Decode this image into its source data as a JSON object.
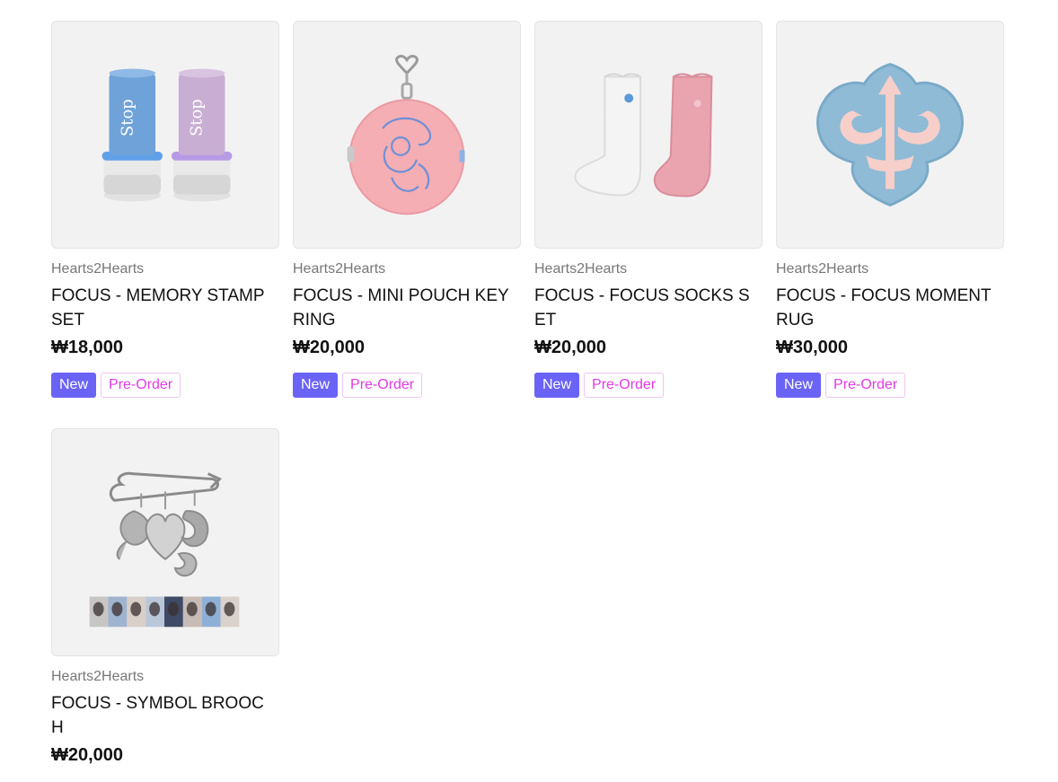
{
  "products": [
    {
      "brand": "Hearts2Hearts",
      "name": "FOCUS - MEMORY STAMP SET",
      "price": "₩18,000",
      "badges": {
        "new": "New",
        "preorder": "Pre-Order"
      },
      "image_icon": "stamp-set-image"
    },
    {
      "brand": "Hearts2Hearts",
      "name": "FOCUS - MINI POUCH KEYRING",
      "price": "₩20,000",
      "badges": {
        "new": "New",
        "preorder": "Pre-Order"
      },
      "image_icon": "pouch-keyring-image"
    },
    {
      "brand": "Hearts2Hearts",
      "name": "FOCUS - FOCUS SOCKS SET",
      "price": "₩20,000",
      "badges": {
        "new": "New",
        "preorder": "Pre-Order"
      },
      "image_icon": "socks-set-image"
    },
    {
      "brand": "Hearts2Hearts",
      "name": "FOCUS - FOCUS MOMENT RUG",
      "price": "₩30,000",
      "badges": {
        "new": "New",
        "preorder": "Pre-Order"
      },
      "image_icon": "moment-rug-image"
    },
    {
      "brand": "Hearts2Hearts",
      "name": "FOCUS - SYMBOL BROOCH",
      "price": "₩20,000",
      "image_icon": "symbol-brooch-image"
    }
  ],
  "colors": {
    "badge_new_bg": "#6b63f5",
    "badge_preorder_text": "#e23ae6",
    "thumb_bg": "#f2f2f2"
  }
}
